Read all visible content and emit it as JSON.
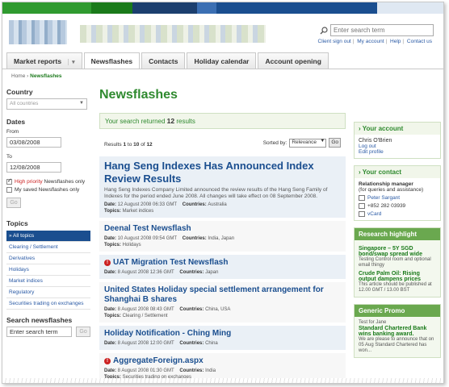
{
  "header": {
    "bar_colors": [
      "#1a7a1a",
      "#2f9a2f",
      "#6fb02f",
      "#1a4e8f",
      "#1c3f6e",
      "#3b6fb3",
      "#dfe8f2"
    ],
    "search_placeholder": "Enter search term",
    "util_links": [
      "Client sign out",
      "My account",
      "Help",
      "Contact us"
    ]
  },
  "tabs": [
    {
      "label": "Market reports",
      "dropdown": "▾"
    },
    {
      "label": "Newsflashes"
    },
    {
      "label": "Contacts"
    },
    {
      "label": "Holiday calendar"
    },
    {
      "label": "Account opening"
    }
  ],
  "breadcrumb": {
    "home": "Home",
    "sep": "›",
    "current": "Newsflashes"
  },
  "filters": {
    "country_heading": "Country",
    "country_value": "All countries",
    "dates_heading": "Dates",
    "from_label": "From",
    "from_value": "03/08/2008",
    "to_label": "To",
    "to_value": "12/08/2008",
    "high_priority_strong": "High priority",
    "high_priority_rest": " Newsflashes only",
    "saved_only": "My saved Newsflashes only",
    "go": "Go",
    "topics_heading": "Topics",
    "topics": [
      "» All topics",
      "Clearing / Settlement",
      "Derivatives",
      "Holidays",
      "Market indices",
      "Regulatory",
      "Securities trading on exchanges"
    ],
    "search_heading": "Search newsflashes",
    "search_placeholder": "Enter search term"
  },
  "main": {
    "title": "Newsflashes",
    "results_prefix": "Your search returned ",
    "results_count": "12",
    "results_suffix": " results",
    "results_range_prefix": "Results ",
    "results_range": "1",
    "results_range_to": " to ",
    "results_range_end": "10",
    "results_of": " of ",
    "results_total": "12",
    "sorted_by_label": "Sorted by:",
    "sort_value": "Relevance",
    "sort_go": "Go"
  },
  "items": [
    {
      "title": "Hang Seng Indexes Has Announced Index Review Results",
      "excerpt": "Hang Seng Indexes Company Limited announced the review results of the Hang Seng Family of Indexes for the period ended June 2008. All changes will take effect on 08 September 2008.",
      "date": "12 August 2008 06:33 GMT",
      "countries": "Australia",
      "topics": "Market indices"
    },
    {
      "title": "Deenal Test Newsflash",
      "date": "10 August 2008 09:54 GMT",
      "countries": "India, Japan",
      "topics": "Holidays"
    },
    {
      "title": "UAT Migration Test Newsflash",
      "date": "8 August 2008 12:36 GMT",
      "countries": "Japan"
    },
    {
      "title": "United States Holiday special settlement arrangement for Shanghai B shares",
      "date": "8 August 2008 08:43 GMT",
      "countries": "China, USA",
      "topics": "Clearing / Settlement"
    },
    {
      "title": "Holiday Notification - Ching Ming",
      "date": "8 August 2008 12:00 GMT",
      "countries": "China"
    },
    {
      "title": "AggregateForeign.aspx",
      "date": "8 August 2008 01:30 GMT",
      "countries": "India",
      "topics": "Securities trading on exchanges"
    }
  ],
  "meta_labels": {
    "date": "Date: ",
    "countries": "Countries: ",
    "topics": "Topics: "
  },
  "account": {
    "heading": "Your account",
    "name": "Chris O'Brien",
    "logout": "Log out",
    "edit": "Edit profile"
  },
  "contact": {
    "heading": "Your contact",
    "role": "Relationship manager",
    "role_sub": "(for queries and assistance)",
    "name": "Peter Sargant",
    "phone": "+852 282 03939",
    "vcard": "vCard"
  },
  "research": {
    "heading": "Research highlight",
    "items": [
      {
        "title": "Singapore – 5Y SGD bond/swap spread wide",
        "sub": "Testing Control room and optional email thingy"
      },
      {
        "title": "Crude Palm Oil: Rising output dampens prices",
        "sub": "This article should be published at 12.00 GMT / 13.00 BST"
      }
    ]
  },
  "promo": {
    "heading": "Generic Promo",
    "lead": "Test for Jane",
    "title": "Standard Chartered Bank wins banking award.",
    "sub": "We are please to announce that on 05 Aug Standard Chartered has won..."
  }
}
